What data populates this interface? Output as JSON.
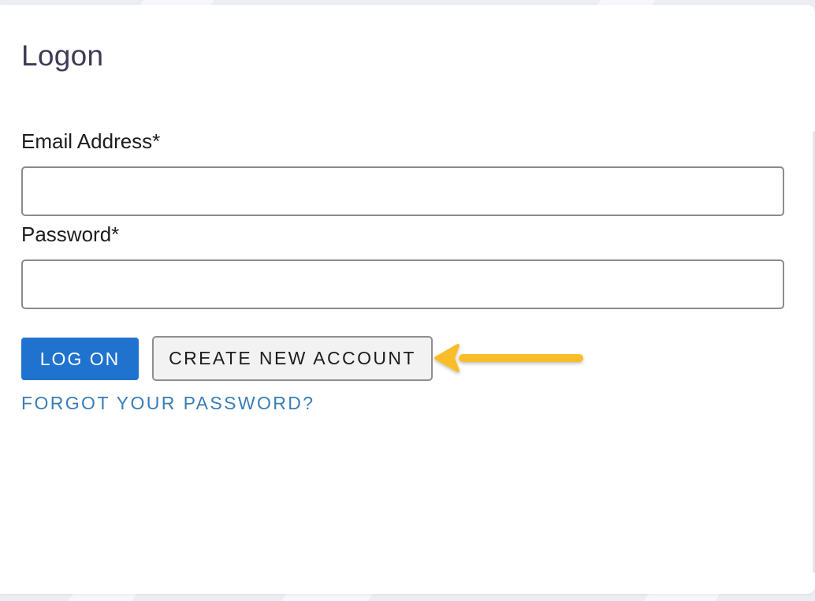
{
  "page": {
    "title": "Logon"
  },
  "form": {
    "email_label": "Email Address*",
    "email_value": "",
    "password_label": "Password*",
    "password_value": ""
  },
  "actions": {
    "logon_label": "LOG ON",
    "create_account_label": "CREATE NEW ACCOUNT",
    "forgot_password_label": "FORGOT YOUR PASSWORD?"
  },
  "annotation": {
    "arrow_color": "#fbbc2c",
    "arrow_icon": "arrow-left-icon"
  },
  "colors": {
    "primary_button": "#1f73cf",
    "link": "#3a7db7",
    "title": "#3e3b55"
  }
}
